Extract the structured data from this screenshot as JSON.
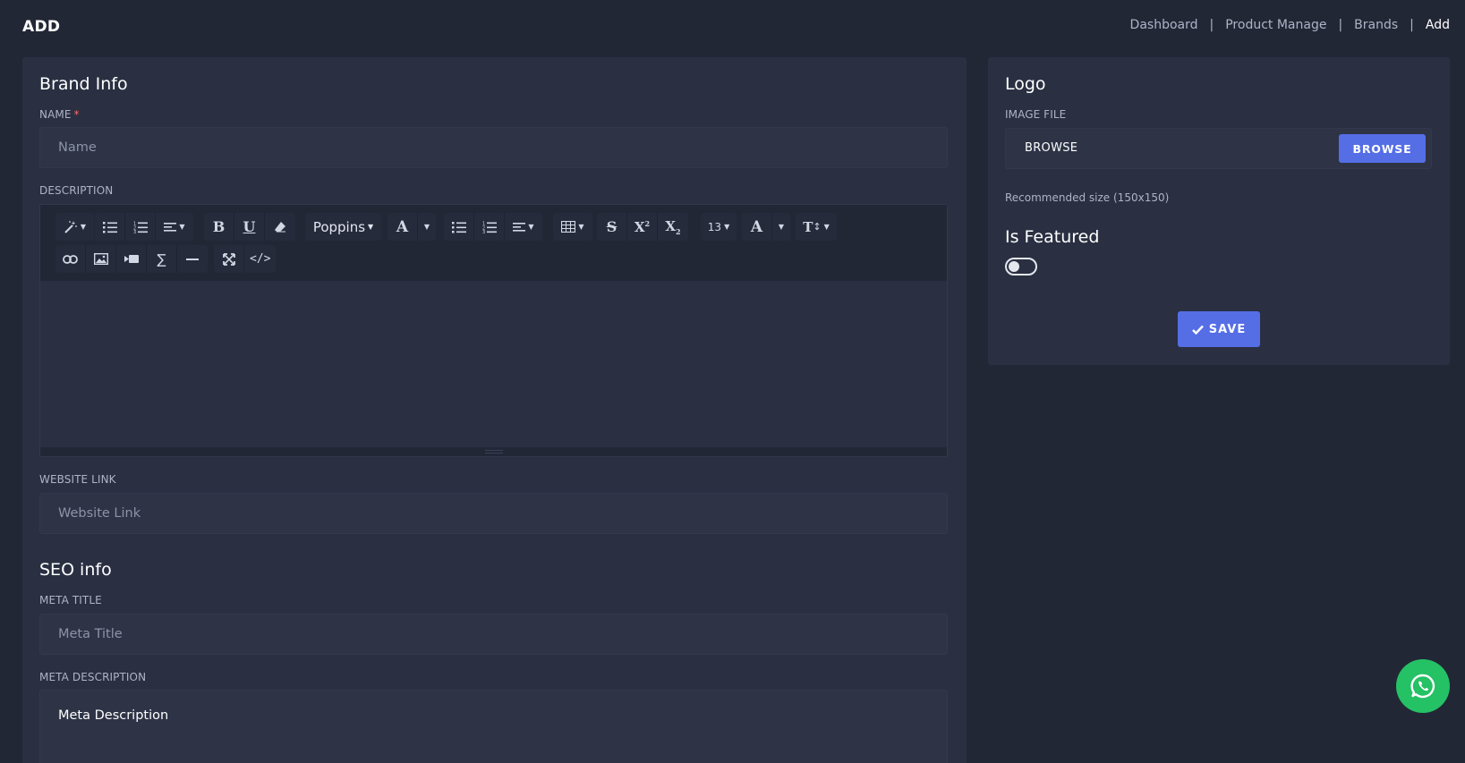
{
  "header": {
    "page_title": "ADD",
    "breadcrumb": [
      "Dashboard",
      "Product Manage",
      "Brands",
      "Add"
    ],
    "separator": "|"
  },
  "brand_info": {
    "title": "Brand Info",
    "name_label": "NAME",
    "required_mark": "*",
    "name_placeholder": "Name",
    "description_label": "DESCRIPTION",
    "website_label": "WEBSITE LINK",
    "website_placeholder": "Website Link"
  },
  "editor_toolbar": {
    "font_name": "Poppins",
    "font_size": "13",
    "icons_row1": [
      "magic-wand",
      "unordered-list",
      "ordered-list",
      "paragraph-align",
      "bold",
      "underline",
      "eraser",
      "font-name",
      "font-color",
      "unordered-list",
      "ordered-list",
      "paragraph-align",
      "table",
      "strikethrough",
      "superscript",
      "subscript",
      "font-size",
      "text-color",
      "line-height"
    ],
    "icons_row2": [
      "link",
      "picture",
      "video",
      "math",
      "horizontal-rule",
      "fullscreen",
      "code-view"
    ]
  },
  "seo_info": {
    "title": "SEO info",
    "meta_title_label": "META TITLE",
    "meta_title_placeholder": "Meta Title",
    "meta_description_label": "META DESCRIPTION",
    "meta_description_value": "Meta Description"
  },
  "logo": {
    "title": "Logo",
    "image_file_label": "IMAGE FILE",
    "file_text": "BROWSE",
    "browse_button": "BROWSE",
    "hint": "Recommended size (150x150)"
  },
  "featured": {
    "title": "Is Featured",
    "enabled": false
  },
  "actions": {
    "save_label": "SAVE"
  },
  "colors": {
    "background": "#222736",
    "card": "#2a3042",
    "primary": "#556ee6",
    "whatsapp": "#25c165",
    "required": "#f46a6a"
  }
}
